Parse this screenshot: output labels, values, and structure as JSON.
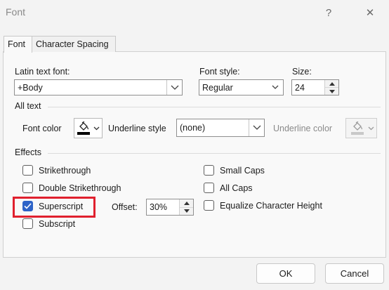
{
  "window": {
    "title": "Font",
    "help_label": "?",
    "close_label": "✕"
  },
  "tabs": [
    {
      "label": "Font",
      "active": true
    },
    {
      "label": "Character Spacing",
      "active": false
    }
  ],
  "latin_font": {
    "label": "Latin text font:",
    "value": "+Body"
  },
  "font_style": {
    "label": "Font style:",
    "value": "Regular"
  },
  "size": {
    "label": "Size:",
    "value": "24"
  },
  "all_text": {
    "heading": "All text",
    "font_color_label": "Font color",
    "font_color": "#000000",
    "underline_style_label": "Underline style",
    "underline_style_value": "(none)",
    "underline_color_label": "Underline color"
  },
  "effects": {
    "heading": "Effects",
    "left": [
      {
        "label": "Strikethrough",
        "checked": false
      },
      {
        "label": "Double Strikethrough",
        "checked": false
      },
      {
        "label": "Superscript",
        "checked": true
      },
      {
        "label": "Subscript",
        "checked": false
      }
    ],
    "offset_label": "Offset:",
    "offset_value": "30%",
    "right": [
      {
        "label": "Small Caps",
        "checked": false
      },
      {
        "label": "All Caps",
        "checked": false
      },
      {
        "label": "Equalize Character Height",
        "checked": false
      }
    ]
  },
  "footer": {
    "ok_label": "OK",
    "cancel_label": "Cancel"
  },
  "colors": {
    "accent": "#2d63c8",
    "highlight": "#e0202e"
  }
}
